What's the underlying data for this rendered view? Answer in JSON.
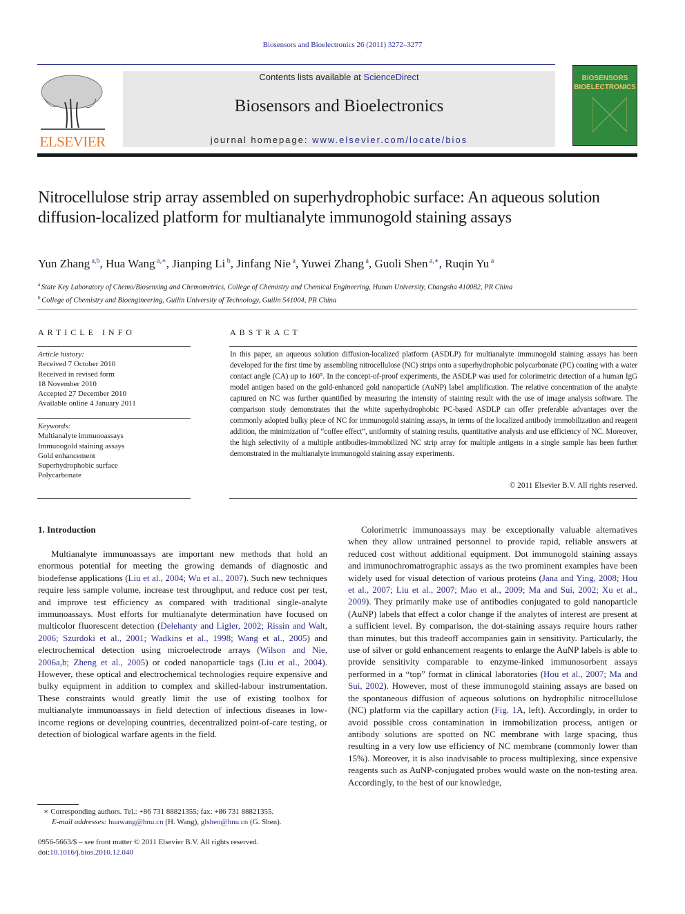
{
  "header": {
    "citation": "Biosensors and Bioelectronics 26 (2011) 3272–3277",
    "contents_prefix": "Contents lists available at ",
    "contents_link": "ScienceDirect",
    "journal_title": "Biosensors and Bioelectronics",
    "homepage_prefix": "journal homepage: ",
    "homepage_link": "www.elsevier.com/locate/bios",
    "publisher_logo_text": "ELSEVIER",
    "cover_title_line1": "BIOSENSORS",
    "cover_title_line2": "BIOELECTRONICS",
    "colors": {
      "link": "#2b2b8c",
      "elsevier_orange": "#e8772a",
      "cover_green": "#2f8a40",
      "masthead_gray": "#e8e8e8"
    }
  },
  "article": {
    "title": "Nitrocellulose strip array assembled on superhydrophobic surface: An aqueous solution diffusion-localized platform for multianalyte immunogold staining assays",
    "authors": [
      {
        "name": "Yun Zhang",
        "sup": "a,b"
      },
      {
        "name": "Hua Wang",
        "sup": "a,∗"
      },
      {
        "name": "Jianping Li",
        "sup": "b"
      },
      {
        "name": "Jinfang Nie",
        "sup": "a"
      },
      {
        "name": "Yuwei Zhang",
        "sup": "a"
      },
      {
        "name": "Guoli Shen",
        "sup": "a,∗"
      },
      {
        "name": "Ruqin Yu",
        "sup": "a"
      }
    ],
    "affiliations": [
      {
        "mark": "a",
        "text": "State Key Laboratory of Chemo/Biosensing and Chemometrics, College of Chemistry and Chemical Engineering, Hunan University, Changsha 410082, PR China"
      },
      {
        "mark": "b",
        "text": "College of Chemistry and Bioengineering, Guilin University of Technology, Guilin 541004, PR China"
      }
    ]
  },
  "article_info": {
    "heading": "ARTICLE INFO",
    "history_label": "Article history:",
    "history": [
      "Received 7 October 2010",
      "Received in revised form",
      "18 November 2010",
      "Accepted 27 December 2010",
      "Available online 4 January 2011"
    ],
    "keywords_label": "Keywords:",
    "keywords": [
      "Multianalyte immunoassays",
      "Immunogold staining assays",
      "Gold enhancement",
      "Superhydrophobic surface",
      "Polycarbonate"
    ]
  },
  "abstract": {
    "heading": "ABSTRACT",
    "body": "In this paper, an aqueous solution diffusion-localized platform (ASDLP) for multianalyte immunogold staining assays has been developed for the first time by assembling nitrocellulose (NC) strips onto a superhydrophobic polycarbonate (PC) coating with a water contact angle (CA) up to 160°. In the concept-of-proof experiments, the ASDLP was used for colorimetric detection of a human IgG model antigen based on the gold-enhanced gold nanoparticle (AuNP) label amplification. The relative concentration of the analyte captured on NC was further quantified by measuring the intensity of staining result with the use of image analysis software. The comparison study demonstrates that the white superhydrophobic PC-based ASDLP can offer preferable advantages over the commonly adopted bulky piece of NC for immunogold staining assays, in terms of the localized antibody immobilization and reagent addition, the minimization of “coffee effect”, uniformity of staining results, quantitative analysis and use efficiency of NC. Moreover, the high selectivity of a multiple antibodies-immobilized NC strip array for multiple antigens in a single sample has been further demonstrated in the multianalyte immunogold staining assay experiments.",
    "copyright": "© 2011 Elsevier B.V. All rights reserved."
  },
  "introduction": {
    "heading": "1.  Introduction",
    "p1": [
      {
        "t": "Multianalyte immunoassays are important new methods that hold an enormous potential for meeting the growing demands of diagnostic and biodefense applications ("
      },
      {
        "t": "Liu et al., 2004; Wu et al., 2007",
        "link": true
      },
      {
        "t": "). Such new techniques require less sample volume, increase test throughput, and reduce cost per test, and improve test efficiency as compared with traditional single-analyte immunoassays. Most efforts for multianalyte determination have focused on multicolor fluorescent detection ("
      },
      {
        "t": "Delehanty and Ligler, 2002; Rissin and Walt, 2006; Szurdoki et al., 2001; Wadkins et al., 1998; Wang et al., 2005",
        "link": true
      },
      {
        "t": ") and electrochemical detection using microelectrode arrays ("
      },
      {
        "t": "Wilson and Nie, 2006a,b; Zheng et al., 2005",
        "link": true
      },
      {
        "t": ") or coded nanoparticle tags ("
      },
      {
        "t": "Liu et al., 2004",
        "link": true
      },
      {
        "t": "). However, these optical and electrochemical technologies require expensive and bulky equipment in addition to complex and skilled-labour instrumentation. These constraints would greatly limit the use of existing toolbox for multianalyte immunoassays in field detection of infectious diseases in low-income regions or developing countries, decentralized point-of-care testing, or detection of biological warfare agents in the field."
      }
    ],
    "p2": [
      {
        "t": "Colorimetric immunoassays may be exceptionally valuable alternatives when they allow untrained personnel to provide rapid, reliable answers at reduced cost without additional equipment. Dot immunogold staining assays and immunochromatrographic assays as the two prominent examples have been widely used for visual detection of various proteins ("
      },
      {
        "t": "Jana and Ying, 2008; Hou et al., 2007; Liu et al., 2007; Mao et al., 2009; Ma and Sui, 2002; Xu et al., 2009",
        "link": true
      },
      {
        "t": "). They primarily make use of antibodies conjugated to gold nanoparticle (AuNP) labels that effect a color change if the analytes of interest are present at a sufficient level. By comparison, the dot-staining assays require hours rather than minutes, but this tradeoff accompanies gain in sensitivity. Particularly, the use of silver or gold enhancement reagents to enlarge the AuNP labels is able to provide sensitivity comparable to enzyme-linked immunosorbent assays performed in a “top” format in clinical laboratories ("
      },
      {
        "t": "Hou et al., 2007; Ma and Sui, 2002",
        "link": true
      },
      {
        "t": "). However, most of these immunogold staining assays are based on the spontaneous diffusion of aqueous solutions on hydrophilic nitrocellulose (NC) platform via the capillary action ("
      },
      {
        "t": "Fig. 1",
        "link": true
      },
      {
        "t": "A, left). Accordingly, in order to avoid possible cross contamination in immobilization process, antigen or antibody solutions are spotted on NC membrane with large spacing, thus resulting in a very low use efficiency of NC membrane (commonly lower than 15%). Moreover, it is also inadvisable to process multiplexing, since expensive reagents such as AuNP-conjugated probes would waste on the non-testing area. Accordingly, to the best of our knowledge,"
      }
    ]
  },
  "footnotes": {
    "corresponding": "∗  Corresponding authors. Tel.: +86 731 88821355; fax: +86 731 88821355.",
    "email_label": "E-mail addresses: ",
    "emails": [
      {
        "address": "huawang@hnu.cn",
        "who": " (H. Wang), "
      },
      {
        "address": "glshen@hnu.cn",
        "who": " (G. Shen)."
      }
    ],
    "issn_line": "0956-5663/$ – see front matter © 2011 Elsevier B.V. All rights reserved.",
    "doi_prefix": "doi:",
    "doi": "10.1016/j.bios.2010.12.040"
  }
}
